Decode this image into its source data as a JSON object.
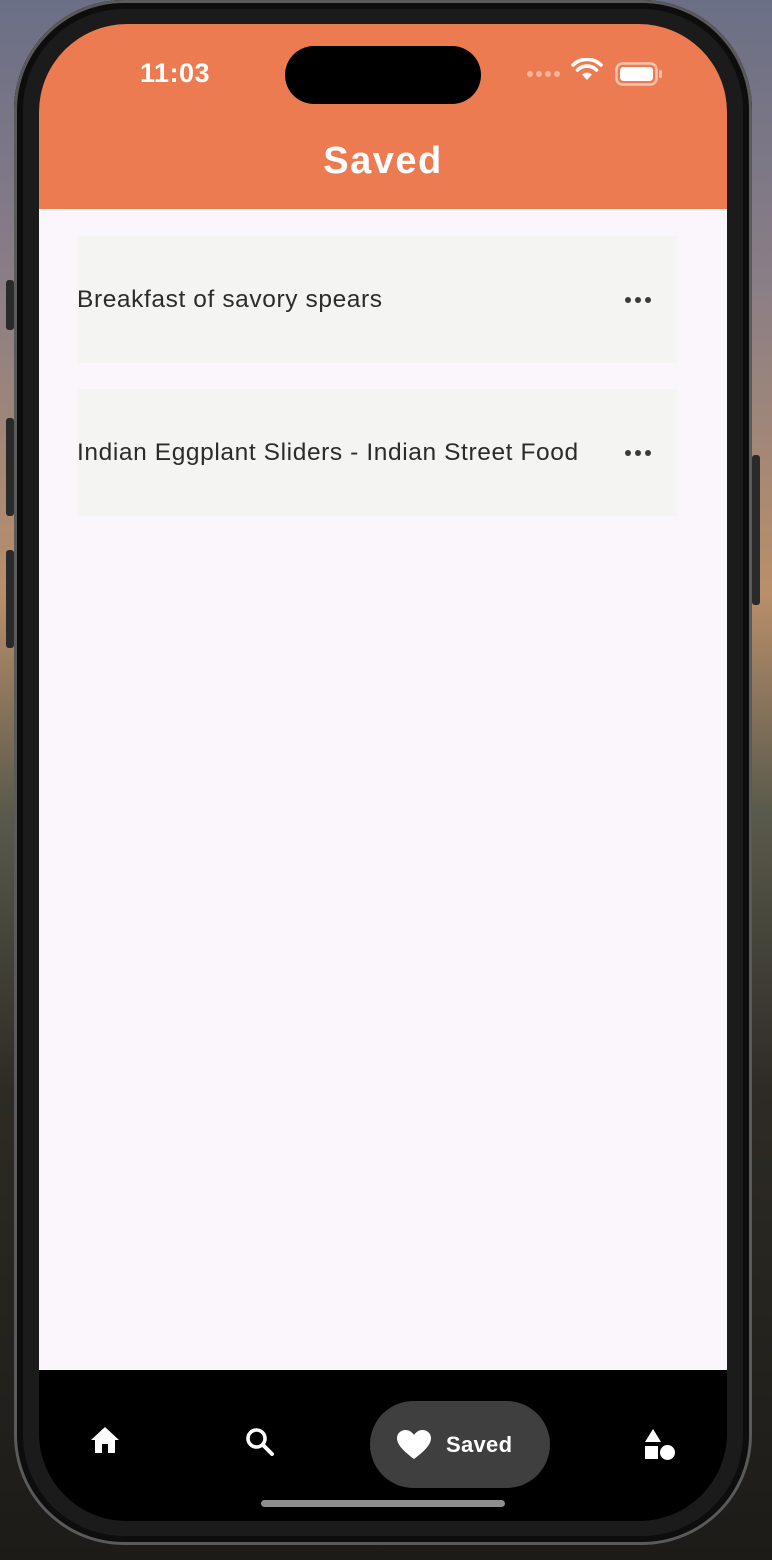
{
  "status_bar": {
    "time": "11:03"
  },
  "header": {
    "title": "Saved"
  },
  "saved_items": [
    {
      "title": "Breakfast of savory spears"
    },
    {
      "title": "Indian Eggplant Sliders - Indian Street Food"
    }
  ],
  "bottom_nav": {
    "items": [
      {
        "icon": "home-icon"
      },
      {
        "icon": "search-icon"
      },
      {
        "icon": "heart-icon",
        "label": "Saved",
        "active": true
      },
      {
        "icon": "shapes-icon"
      }
    ]
  },
  "colors": {
    "accent": "#ed7b51",
    "content_bg": "#faf6fb",
    "card_bg": "#f4f4f3",
    "nav_bg": "#000000",
    "nav_active_pill": "#3f3f3f"
  }
}
